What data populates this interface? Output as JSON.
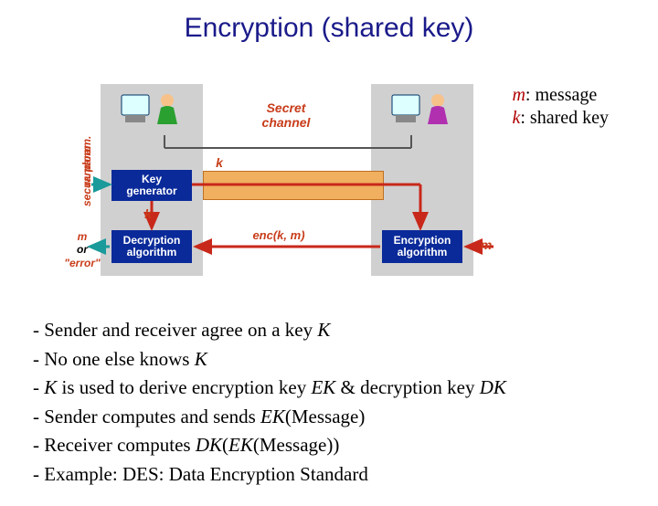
{
  "title": "Encryption (shared key)",
  "legend": {
    "m_var": "m",
    "m_desc": ": message",
    "k_var": "k",
    "k_desc": ": shared key"
  },
  "diagram": {
    "secret_channel": "Secret channel",
    "key_generator": "Key generator",
    "decryption_alg": "Decryption algorithm",
    "encryption_alg": "Encryption algorithm",
    "random_label_a": "random",
    "random_label_b": "secur. param.",
    "k_label": "k",
    "enc_label": "enc(k, m)",
    "m_label": "m",
    "out_m": "m",
    "out_or": "or",
    "out_error": "\"error\""
  },
  "bullets": [
    {
      "pre": "- Sender and receiver agree on a key ",
      "it": "K",
      "post": ""
    },
    {
      "pre": "- No one else knows ",
      "it": "K",
      "post": ""
    },
    {
      "pre": "- ",
      "it": "K",
      "post": " is used to derive encryption key ",
      "it2": "EK",
      "post2": " & decryption key ",
      "it3": "DK"
    },
    {
      "pre": "- Sender computes and sends ",
      "it": "EK",
      "post": "(Message)"
    },
    {
      "pre": "- Receiver computes ",
      "it": "DK",
      "post": "(",
      "it2": "EK",
      "post2": "(Message))"
    },
    {
      "pre": "- Example: DES: Data Encryption Standard",
      "it": "",
      "post": ""
    }
  ]
}
